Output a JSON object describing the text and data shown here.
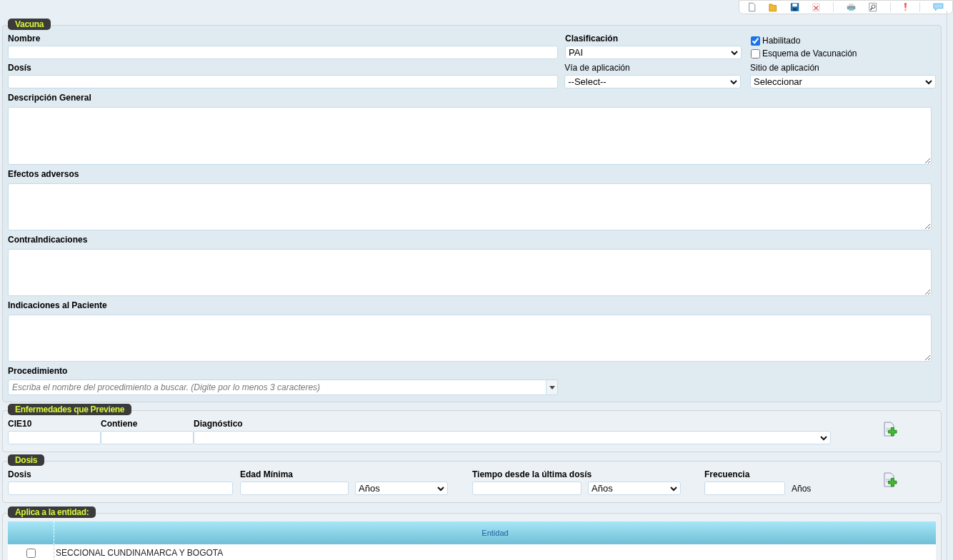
{
  "vacuna": {
    "legend": "Vacuna",
    "nombre": {
      "label": "Nombre"
    },
    "clasificacion": {
      "label": "Clasificación",
      "value": "PAI"
    },
    "habilitado": {
      "label": "Habilitado",
      "checked": true
    },
    "esquema": {
      "label": "Esquema de Vacunación",
      "checked": false
    },
    "dosis": {
      "label": "Dosís"
    },
    "via": {
      "label": "Vía de aplicación",
      "value": "--Select--"
    },
    "sitio": {
      "label": "Sitio de aplicación",
      "value": "Seleccionar"
    },
    "text_areas": [
      {
        "label": "Descripción General"
      },
      {
        "label": "Efectos adversos"
      },
      {
        "label": "ContraIndicaciones"
      },
      {
        "label": "Indicaciones al Paciente"
      }
    ],
    "procedimiento": {
      "label": "Procedimiento",
      "placeholder": "Escriba el nombre del procedimiento a buscar. (Digite por lo menos 3 caracteres)"
    }
  },
  "enfermedades": {
    "legend": "Enfermedades que Previene",
    "fields": [
      {
        "label": "CIE10",
        "kind": "input"
      },
      {
        "label": "Contiene",
        "kind": "input"
      },
      {
        "label": "Diagnóstico",
        "kind": "select"
      }
    ]
  },
  "dosis": {
    "legend": "Dosis",
    "fields": [
      {
        "label": "Dosis",
        "kind": "input"
      },
      {
        "label": "Edad Mínima",
        "kind": "input_select",
        "unit": "Años"
      },
      {
        "label": "Tiempo desde la última dosís",
        "kind": "input_select",
        "unit": "Años"
      },
      {
        "label": "Frecuencia",
        "kind": "input_unit",
        "unit": "Años"
      }
    ]
  },
  "entidad": {
    "legend": "Aplica a la entidad:",
    "table": {
      "columns": [
        "Entidad"
      ],
      "rows": [
        {
          "checked": false,
          "entidad": "SECCIONAL CUNDINAMARCA Y BOGOTA"
        }
      ]
    }
  }
}
